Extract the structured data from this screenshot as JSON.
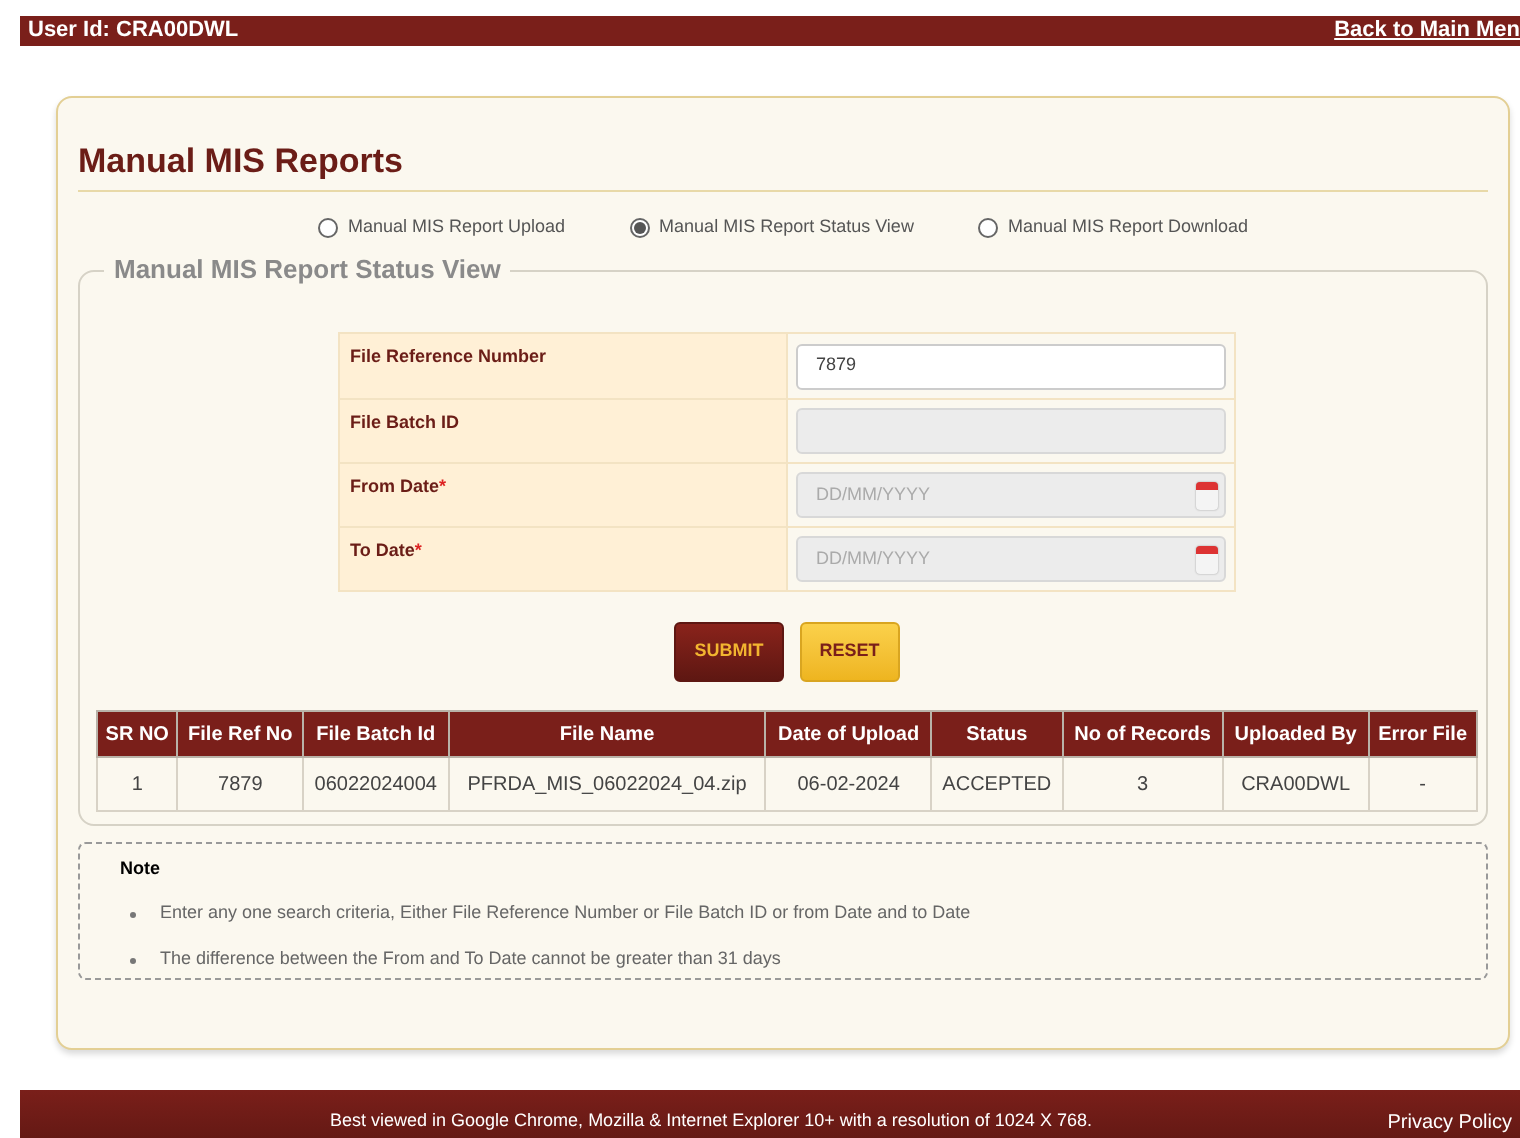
{
  "top_bar": {
    "user_id": "User Id: CRA00DWL",
    "back_link": "Back to Main Men"
  },
  "page_title": "Manual MIS Reports",
  "options": [
    {
      "label": "Manual MIS Report Upload",
      "selected": false
    },
    {
      "label": "Manual MIS Report Status View",
      "selected": true
    },
    {
      "label": "Manual MIS Report Download",
      "selected": false
    }
  ],
  "section_title": "Manual MIS Report Status View",
  "form": [
    {
      "label": "File Reference Number",
      "kind": "text",
      "value": "7879",
      "disabled": false
    },
    {
      "label": "File Batch ID",
      "kind": "text",
      "disabled": true
    },
    {
      "label": "From Date",
      "required_mark": "*",
      "kind": "date",
      "placeholder": "DD/MM/YYYY",
      "disabled": true
    },
    {
      "label": "To Date",
      "required_mark": "*",
      "kind": "date",
      "placeholder": "DD/MM/YYYY",
      "disabled": true
    }
  ],
  "buttons": [
    {
      "label": "SUBMIT",
      "kind": "primary"
    },
    {
      "label": "RESET",
      "kind": "secondary"
    }
  ],
  "table": {
    "columns": [
      "SR NO",
      "File Ref No",
      "File Batch Id",
      "File Name",
      "Date of Upload",
      "Status",
      "No of Records",
      "Uploaded By",
      "Error File"
    ],
    "rows": [
      [
        "1",
        "7879",
        "06022024004",
        "PFRDA_MIS_06022024_04.zip",
        "06-02-2024",
        "ACCEPTED",
        "3",
        "CRA00DWL",
        "-"
      ]
    ]
  },
  "note": {
    "title": "Note",
    "items": [
      "Enter any one search criteria, Either File Reference Number or File Batch ID or from Date and to Date",
      "The difference between the From and To Date cannot be greater than 31 days"
    ]
  },
  "footer": {
    "text": "Best viewed in Google Chrome, Mozilla & Internet Explorer 10+ with a resolution of 1024 X 768.",
    "link": "Privacy Policy"
  }
}
